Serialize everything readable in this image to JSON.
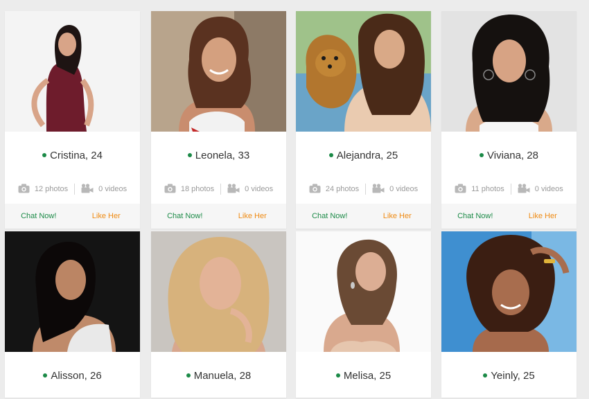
{
  "colors": {
    "online": "#1b8a47",
    "chat": "#1b8a47",
    "like": "#ef8a12",
    "muted": "#9a9a9a"
  },
  "icons": {
    "photos": "camera-icon",
    "videos": "video-camera-icon",
    "status": "online-dot-icon"
  },
  "actions": {
    "chat_label": "Chat Now!",
    "like_label": "Like Her"
  },
  "profiles": [
    {
      "name": "Cristina, 24",
      "photos": "12 photos",
      "videos": "0 videos"
    },
    {
      "name": "Leonela, 33",
      "photos": "18 photos",
      "videos": "0 videos"
    },
    {
      "name": "Alejandra, 25",
      "photos": "24 photos",
      "videos": "0 videos"
    },
    {
      "name": "Viviana, 28",
      "photos": "11 photos",
      "videos": "0 videos"
    },
    {
      "name": "Alisson, 26"
    },
    {
      "name": "Manuela, 28"
    },
    {
      "name": "Melisa, 25"
    },
    {
      "name": "Yeinly, 25"
    }
  ]
}
